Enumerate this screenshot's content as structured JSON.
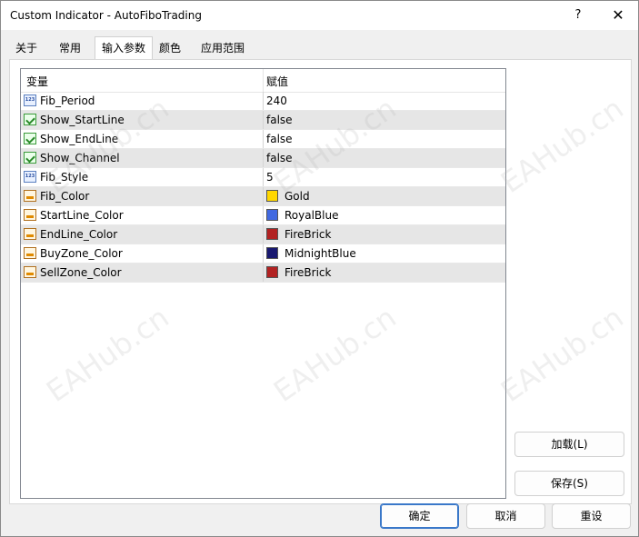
{
  "window": {
    "title": "Custom Indicator - AutoFiboTrading",
    "help_label": "?",
    "close_label": "✕"
  },
  "tabs": [
    {
      "label": "关于"
    },
    {
      "label": "常用"
    },
    {
      "label": "输入参数"
    },
    {
      "label": "颜色"
    },
    {
      "label": "应用范围"
    }
  ],
  "grid": {
    "headers": {
      "variable": "变量",
      "value": "赋值"
    },
    "rows": [
      {
        "name": "Fib_Period",
        "value": "240",
        "type": "number-icon"
      },
      {
        "name": "Show_StartLine",
        "value": "false",
        "type": "bool-icon"
      },
      {
        "name": "Show_EndLine",
        "value": "false",
        "type": "bool-icon"
      },
      {
        "name": "Show_Channel",
        "value": "false",
        "type": "bool-icon"
      },
      {
        "name": "Fib_Style",
        "value": "5",
        "type": "number-icon"
      },
      {
        "name": "Fib_Color",
        "value": "Gold",
        "type": "color-icon",
        "swatch": "#FFD700"
      },
      {
        "name": "StartLine_Color",
        "value": "RoyalBlue",
        "type": "color-icon",
        "swatch": "#4169E1"
      },
      {
        "name": "EndLine_Color",
        "value": "FireBrick",
        "type": "color-icon",
        "swatch": "#B22222"
      },
      {
        "name": "BuyZone_Color",
        "value": "MidnightBlue",
        "type": "color-icon",
        "swatch": "#191970"
      },
      {
        "name": "SellZone_Color",
        "value": "FireBrick",
        "type": "color-icon",
        "swatch": "#B22222"
      }
    ]
  },
  "side_buttons": {
    "load": "加载(L)",
    "save": "保存(S)"
  },
  "footer_buttons": {
    "ok": "确定",
    "cancel": "取消",
    "reset": "重设"
  },
  "watermark": "EAHub.cn"
}
